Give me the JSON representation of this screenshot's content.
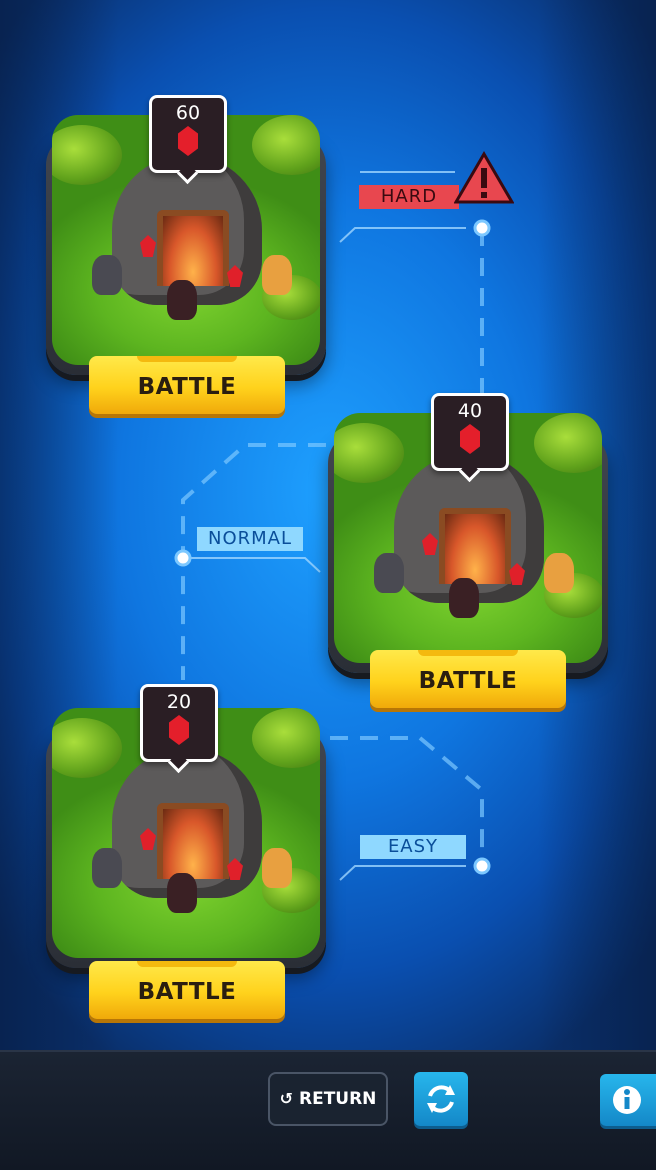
{
  "levels": [
    {
      "difficulty": "HARD",
      "cost": "60",
      "button_label": "BATTLE"
    },
    {
      "difficulty": "NORMAL",
      "cost": "40",
      "button_label": "BATTLE"
    },
    {
      "difficulty": "EASY",
      "cost": "20",
      "button_label": "BATTLE"
    }
  ],
  "bottom_bar": {
    "return_label": "RETURN",
    "return_icon": "return-arrow-icon",
    "refresh_icon": "refresh-icon",
    "info_icon": "info-icon"
  },
  "colors": {
    "hard_tag": "#e8474f",
    "normal_easy_tag": "#8fd8ff",
    "battle_button": "#ffd21c",
    "gem": "#e41f2b",
    "icon_button": "#1e9fdb"
  }
}
